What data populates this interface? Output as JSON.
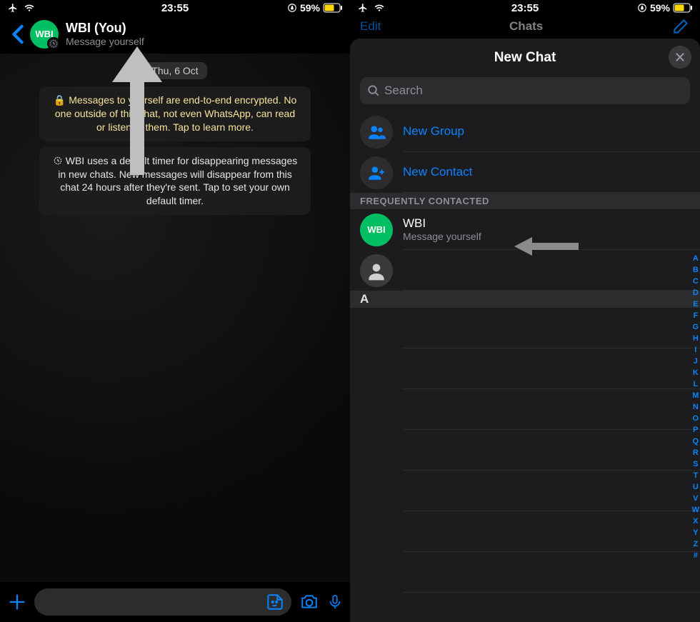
{
  "status": {
    "time": "23:55",
    "battery_text": "59%"
  },
  "left": {
    "header": {
      "title": "WBI (You)",
      "subtitle": "Message yourself",
      "avatar_label": "WBI"
    },
    "date": "Thu, 6 Oct",
    "encryption_notice": "Messages to yourself are end-to-end encrypted. No one outside of this chat, not even WhatsApp, can read or listen to them. Tap to learn more.",
    "timer_notice": "WBI uses a default timer for disappearing messages in new chats. New messages will disappear from this chat 24 hours after they're sent. Tap to set your own default timer."
  },
  "right": {
    "chats_header": {
      "edit": "Edit",
      "title": "Chats"
    },
    "sheet": {
      "title": "New Chat",
      "search_placeholder": "Search",
      "new_group": "New Group",
      "new_contact": "New Contact",
      "section_freq": "Frequently Contacted",
      "wbi": {
        "name": "WBI",
        "sub": "Message yourself",
        "avatar_label": "WBI"
      },
      "letter_a": "A",
      "index": [
        "A",
        "B",
        "C",
        "D",
        "E",
        "F",
        "G",
        "H",
        "I",
        "J",
        "K",
        "L",
        "M",
        "N",
        "O",
        "P",
        "Q",
        "R",
        "S",
        "T",
        "U",
        "V",
        "W",
        "X",
        "Y",
        "Z",
        "#"
      ]
    }
  }
}
